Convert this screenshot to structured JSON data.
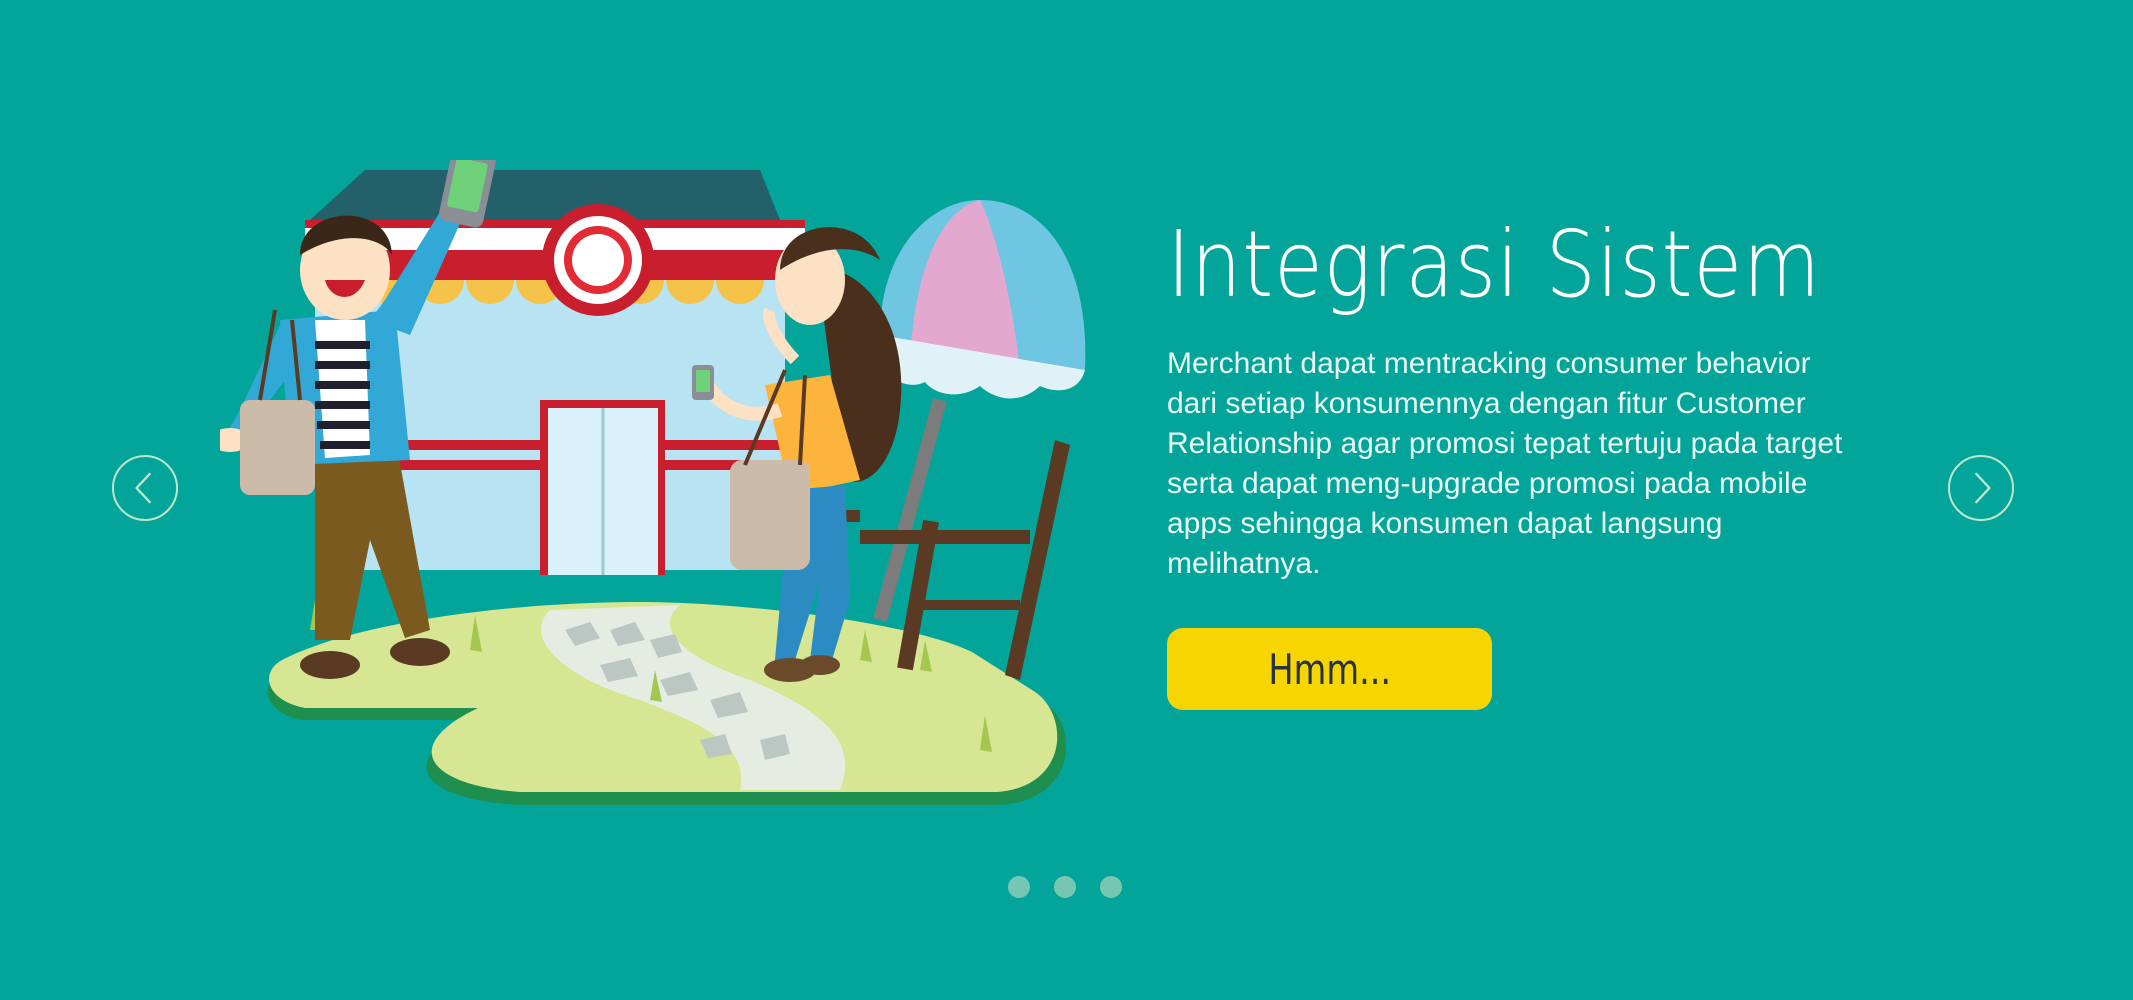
{
  "slide": {
    "title": "Integrasi Sistem",
    "description": "Merchant dapat mentracking consumer behavior dari setiap konsumennya dengan fitur Customer Relationship agar promosi tepat tertuju pada target serta dapat meng-upgrade promosi pada mobile apps sehingga konsumen dapat langsung melihatnya.",
    "cta_label": "Hmm..."
  },
  "navigation": {
    "prev_icon": "chevron-left-icon",
    "next_icon": "chevron-right-icon",
    "dots": 3
  },
  "colors": {
    "background": "#03a59b",
    "button": "#f7d500",
    "arrow_border": "#bfe6c9",
    "dot": "#7cc7b4"
  }
}
